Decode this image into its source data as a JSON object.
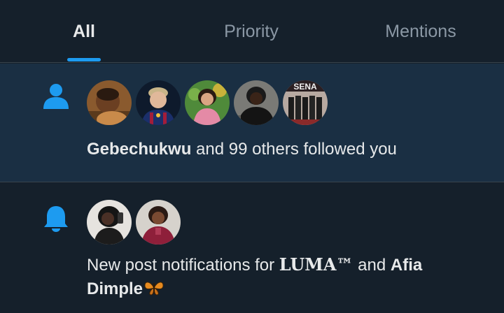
{
  "tabs": [
    {
      "label": "All",
      "active": true
    },
    {
      "label": "Priority",
      "active": false
    },
    {
      "label": "Mentions",
      "active": false
    }
  ],
  "accent_color": "#1d9bf0",
  "notifications": [
    {
      "type": "follow",
      "icon": "person-icon",
      "highlighted": true,
      "avatars": [
        "avatar-1",
        "avatar-2",
        "avatar-3",
        "avatar-4",
        "avatar-5"
      ],
      "actor": "Gebechukwu",
      "text": " and 99 others followed you"
    },
    {
      "type": "subscription",
      "icon": "bell-icon",
      "highlighted": false,
      "avatars": [
        "avatar-1",
        "avatar-2"
      ],
      "prefix": "New post notifications for ",
      "name1": "LUMA™",
      "joiner": " and ",
      "name2": "Afia Dimple",
      "emoji": "butterfly-icon"
    }
  ]
}
